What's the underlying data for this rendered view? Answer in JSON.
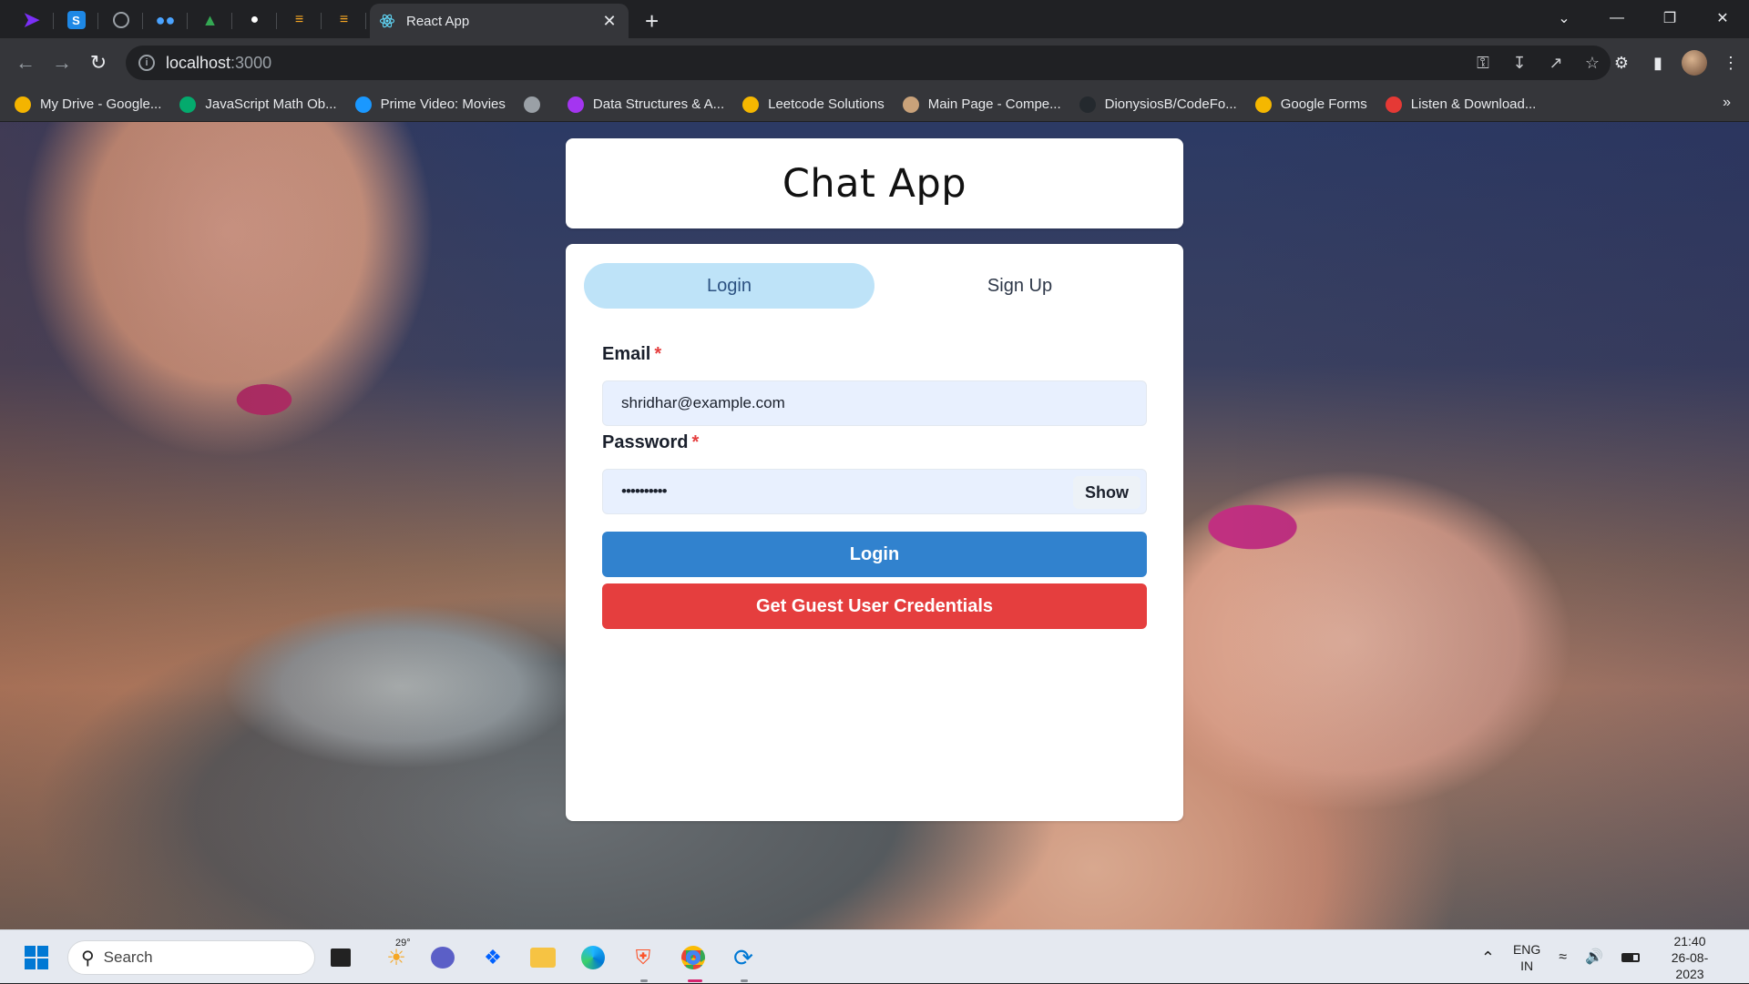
{
  "browser": {
    "active_tab_title": "React App",
    "url_host": "localhost",
    "url_port": ":3000",
    "pinned_tabs": [
      "prime-video-icon",
      "s-app-icon",
      "globe-icon",
      "dots-app-icon",
      "google-drive-icon",
      "notification-icon",
      "bolt-icon",
      "bolt-icon-2"
    ]
  },
  "bookmarks": [
    {
      "label": "My Drive - Google...",
      "icon": "google-drive-icon",
      "color": "#f4b400"
    },
    {
      "label": "JavaScript Math Ob...",
      "icon": "w3schools-icon",
      "color": "#04aa6d"
    },
    {
      "label": "Prime Video: Movies",
      "icon": "prime-video-icon",
      "color": "#1a98ff"
    },
    {
      "label": "",
      "icon": "globe-icon",
      "color": "#9aa0a6"
    },
    {
      "label": "Data Structures & A...",
      "icon": "udemy-icon",
      "color": "#a435f0"
    },
    {
      "label": "Leetcode Solutions",
      "icon": "emoji-icon",
      "color": "#f5b700"
    },
    {
      "label": "Main Page - Compe...",
      "icon": "wiki-icon",
      "color": "#c9a27a"
    },
    {
      "label": "DionysiosB/CodeFo...",
      "icon": "github-icon",
      "color": "#24292e"
    },
    {
      "label": "Google Forms",
      "icon": "emoji-icon-2",
      "color": "#f5b700"
    },
    {
      "label": "Listen & Download...",
      "icon": "music-icon",
      "color": "#e53935"
    }
  ],
  "app": {
    "title": "Chat App",
    "tabs": {
      "login": "Login",
      "signup": "Sign Up"
    },
    "form": {
      "email_label": "Email",
      "email_value": "shridhar@example.com",
      "password_label": "Password",
      "password_value": "••••••••••",
      "required_mark": "*",
      "show_label": "Show",
      "login_button": "Login",
      "guest_button": "Get Guest User Credentials"
    },
    "colors": {
      "tab_active": "#bee3f8",
      "login_button": "#3182ce",
      "guest_button": "#e53e3e"
    }
  },
  "taskbar": {
    "search_placeholder": "Search",
    "weather_temp": "29°",
    "language_line1": "ENG",
    "language_line2": "IN",
    "time": "21:40",
    "date": "26-08-2023"
  }
}
